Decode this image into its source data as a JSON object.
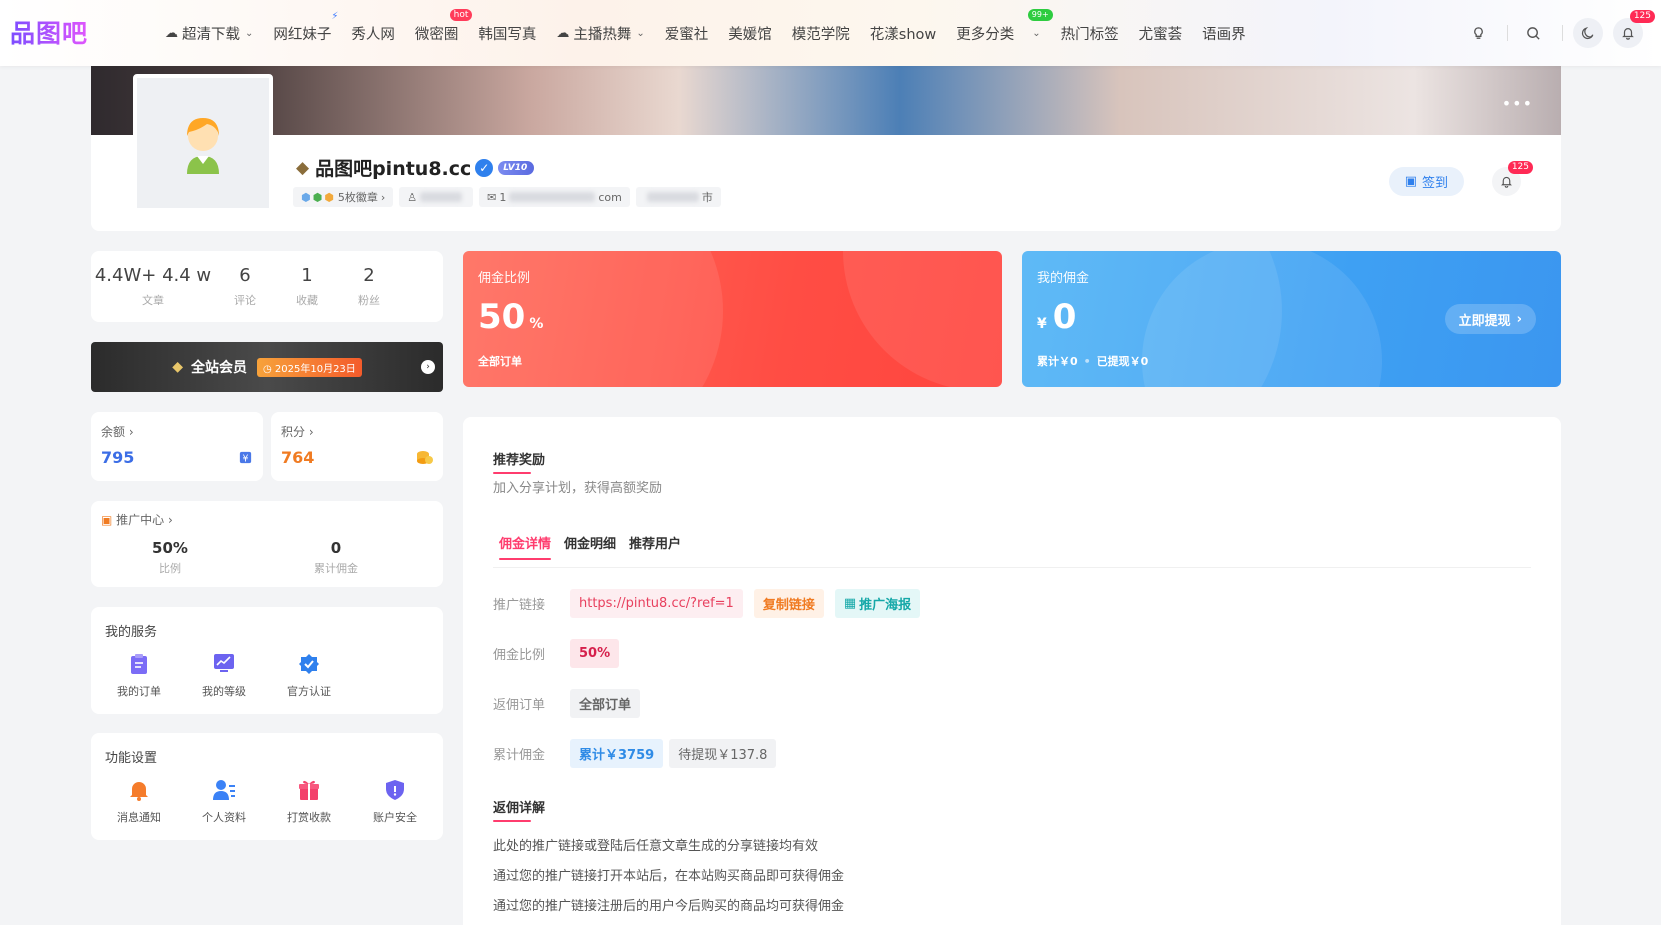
{
  "logo": "品图吧",
  "nav": [
    {
      "label": "超清下载",
      "cloud": true,
      "chevron": true
    },
    {
      "label": "网红妹子",
      "bolt": true
    },
    {
      "label": "秀人网"
    },
    {
      "label": "微密圈",
      "badge": "hot"
    },
    {
      "label": "韩国写真"
    },
    {
      "label": "主播热舞",
      "cloud": true,
      "chevron": true
    },
    {
      "label": "爱蜜社"
    },
    {
      "label": "美媛馆"
    },
    {
      "label": "模范学院"
    },
    {
      "label": "花漾show"
    },
    {
      "label": "更多分类",
      "badge99": "99+",
      "chevron": true
    },
    {
      "label": "热门标签"
    },
    {
      "label": "尤蜜荟"
    },
    {
      "label": "语画界"
    }
  ],
  "header": {
    "bell_badge": "125"
  },
  "profile": {
    "name": "品图吧pintu8.cc",
    "level": "LV10",
    "medals": "5枚徽章",
    "email_start": "1",
    "email_end": "com",
    "city_end": "市",
    "sign_label": "签到",
    "bell_badge": "125"
  },
  "stats": [
    {
      "value": "4.4W+ 4.4 w",
      "label": "文章"
    },
    {
      "value": "6",
      "label": "评论"
    },
    {
      "value": "1",
      "label": "收藏"
    },
    {
      "value": "2",
      "label": "粉丝"
    }
  ],
  "vip": {
    "label": "全站会员",
    "date": "2025年10月23日"
  },
  "balance": {
    "label": "余额",
    "value": "795",
    "color": "#3c6ee6"
  },
  "points": {
    "label": "积分",
    "value": "764",
    "color": "#f07b22"
  },
  "promo": {
    "title": "推广中心",
    "items": [
      {
        "value": "50%",
        "label": "比例"
      },
      {
        "value": "0",
        "label": "累计佣金"
      }
    ]
  },
  "services": {
    "title": "我的服务",
    "items": [
      {
        "label": "我的订单",
        "icon": "order-icon"
      },
      {
        "label": "我的等级",
        "icon": "level-icon"
      },
      {
        "label": "官方认证",
        "icon": "verify-icon"
      }
    ]
  },
  "settings": {
    "title": "功能设置",
    "items": [
      {
        "label": "消息通知",
        "icon": "bell-icon"
      },
      {
        "label": "个人资料",
        "icon": "profile-icon"
      },
      {
        "label": "打赏收款",
        "icon": "gift-icon"
      },
      {
        "label": "账户安全",
        "icon": "shield-icon"
      }
    ]
  },
  "rate_card": {
    "label": "佣金比例",
    "value": "50",
    "unit": "%",
    "sub": "全部订单"
  },
  "commission_card": {
    "label": "我的佣金",
    "currency": "¥",
    "value": "0",
    "total": "累计￥0",
    "withdrawn": "已提现￥0",
    "withdraw_btn": "立即提现"
  },
  "reward": {
    "title": "推荐奖励",
    "subtitle": "加入分享计划，获得高额奖励",
    "tabs": [
      "佣金详情",
      "佣金明细",
      "推荐用户"
    ],
    "link_label": "推广链接",
    "link": "https://pintu8.cc/?ref=1",
    "copy_btn": "复制链接",
    "poster_btn": "推广海报",
    "rate_label": "佣金比例",
    "rate": "50%",
    "order_label": "返佣订单",
    "order_value": "全部订单",
    "total_label": "累计佣金",
    "total_value": "累计￥3759",
    "pending_value": "待提现￥137.8"
  },
  "detail": {
    "title": "返佣详解",
    "lines": [
      "此处的推广链接或登陆后任意文章生成的分享链接均有效",
      "通过您的推广链接打开本站后，在本站购买商品即可获得佣金",
      "通过您的推广链接注册后的用户今后购买的商品均可获得佣金"
    ]
  }
}
